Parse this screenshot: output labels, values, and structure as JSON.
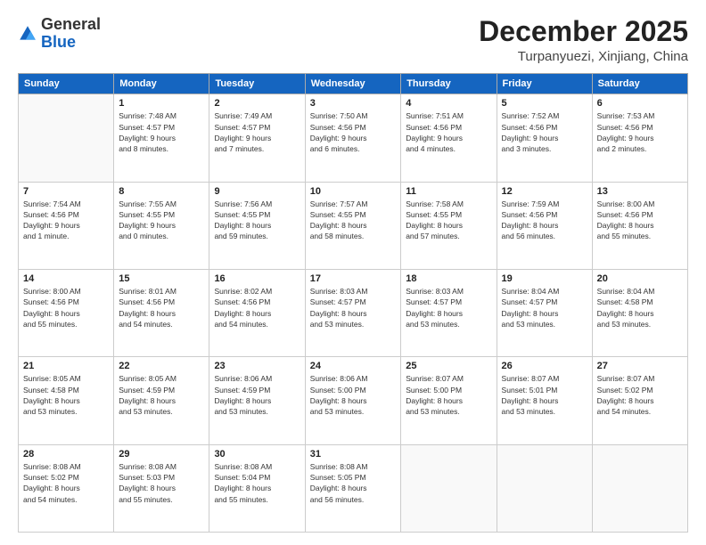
{
  "header": {
    "logo_line1": "General",
    "logo_line2": "Blue",
    "month": "December 2025",
    "location": "Turpanyuezi, Xinjiang, China"
  },
  "days_of_week": [
    "Sunday",
    "Monday",
    "Tuesday",
    "Wednesday",
    "Thursday",
    "Friday",
    "Saturday"
  ],
  "weeks": [
    [
      {
        "day": "",
        "info": ""
      },
      {
        "day": "1",
        "info": "Sunrise: 7:48 AM\nSunset: 4:57 PM\nDaylight: 9 hours\nand 8 minutes."
      },
      {
        "day": "2",
        "info": "Sunrise: 7:49 AM\nSunset: 4:57 PM\nDaylight: 9 hours\nand 7 minutes."
      },
      {
        "day": "3",
        "info": "Sunrise: 7:50 AM\nSunset: 4:56 PM\nDaylight: 9 hours\nand 6 minutes."
      },
      {
        "day": "4",
        "info": "Sunrise: 7:51 AM\nSunset: 4:56 PM\nDaylight: 9 hours\nand 4 minutes."
      },
      {
        "day": "5",
        "info": "Sunrise: 7:52 AM\nSunset: 4:56 PM\nDaylight: 9 hours\nand 3 minutes."
      },
      {
        "day": "6",
        "info": "Sunrise: 7:53 AM\nSunset: 4:56 PM\nDaylight: 9 hours\nand 2 minutes."
      }
    ],
    [
      {
        "day": "7",
        "info": "Sunrise: 7:54 AM\nSunset: 4:56 PM\nDaylight: 9 hours\nand 1 minute."
      },
      {
        "day": "8",
        "info": "Sunrise: 7:55 AM\nSunset: 4:55 PM\nDaylight: 9 hours\nand 0 minutes."
      },
      {
        "day": "9",
        "info": "Sunrise: 7:56 AM\nSunset: 4:55 PM\nDaylight: 8 hours\nand 59 minutes."
      },
      {
        "day": "10",
        "info": "Sunrise: 7:57 AM\nSunset: 4:55 PM\nDaylight: 8 hours\nand 58 minutes."
      },
      {
        "day": "11",
        "info": "Sunrise: 7:58 AM\nSunset: 4:55 PM\nDaylight: 8 hours\nand 57 minutes."
      },
      {
        "day": "12",
        "info": "Sunrise: 7:59 AM\nSunset: 4:56 PM\nDaylight: 8 hours\nand 56 minutes."
      },
      {
        "day": "13",
        "info": "Sunrise: 8:00 AM\nSunset: 4:56 PM\nDaylight: 8 hours\nand 55 minutes."
      }
    ],
    [
      {
        "day": "14",
        "info": "Sunrise: 8:00 AM\nSunset: 4:56 PM\nDaylight: 8 hours\nand 55 minutes."
      },
      {
        "day": "15",
        "info": "Sunrise: 8:01 AM\nSunset: 4:56 PM\nDaylight: 8 hours\nand 54 minutes."
      },
      {
        "day": "16",
        "info": "Sunrise: 8:02 AM\nSunset: 4:56 PM\nDaylight: 8 hours\nand 54 minutes."
      },
      {
        "day": "17",
        "info": "Sunrise: 8:03 AM\nSunset: 4:57 PM\nDaylight: 8 hours\nand 53 minutes."
      },
      {
        "day": "18",
        "info": "Sunrise: 8:03 AM\nSunset: 4:57 PM\nDaylight: 8 hours\nand 53 minutes."
      },
      {
        "day": "19",
        "info": "Sunrise: 8:04 AM\nSunset: 4:57 PM\nDaylight: 8 hours\nand 53 minutes."
      },
      {
        "day": "20",
        "info": "Sunrise: 8:04 AM\nSunset: 4:58 PM\nDaylight: 8 hours\nand 53 minutes."
      }
    ],
    [
      {
        "day": "21",
        "info": "Sunrise: 8:05 AM\nSunset: 4:58 PM\nDaylight: 8 hours\nand 53 minutes."
      },
      {
        "day": "22",
        "info": "Sunrise: 8:05 AM\nSunset: 4:59 PM\nDaylight: 8 hours\nand 53 minutes."
      },
      {
        "day": "23",
        "info": "Sunrise: 8:06 AM\nSunset: 4:59 PM\nDaylight: 8 hours\nand 53 minutes."
      },
      {
        "day": "24",
        "info": "Sunrise: 8:06 AM\nSunset: 5:00 PM\nDaylight: 8 hours\nand 53 minutes."
      },
      {
        "day": "25",
        "info": "Sunrise: 8:07 AM\nSunset: 5:00 PM\nDaylight: 8 hours\nand 53 minutes."
      },
      {
        "day": "26",
        "info": "Sunrise: 8:07 AM\nSunset: 5:01 PM\nDaylight: 8 hours\nand 53 minutes."
      },
      {
        "day": "27",
        "info": "Sunrise: 8:07 AM\nSunset: 5:02 PM\nDaylight: 8 hours\nand 54 minutes."
      }
    ],
    [
      {
        "day": "28",
        "info": "Sunrise: 8:08 AM\nSunset: 5:02 PM\nDaylight: 8 hours\nand 54 minutes."
      },
      {
        "day": "29",
        "info": "Sunrise: 8:08 AM\nSunset: 5:03 PM\nDaylight: 8 hours\nand 55 minutes."
      },
      {
        "day": "30",
        "info": "Sunrise: 8:08 AM\nSunset: 5:04 PM\nDaylight: 8 hours\nand 55 minutes."
      },
      {
        "day": "31",
        "info": "Sunrise: 8:08 AM\nSunset: 5:05 PM\nDaylight: 8 hours\nand 56 minutes."
      },
      {
        "day": "",
        "info": ""
      },
      {
        "day": "",
        "info": ""
      },
      {
        "day": "",
        "info": ""
      }
    ]
  ]
}
